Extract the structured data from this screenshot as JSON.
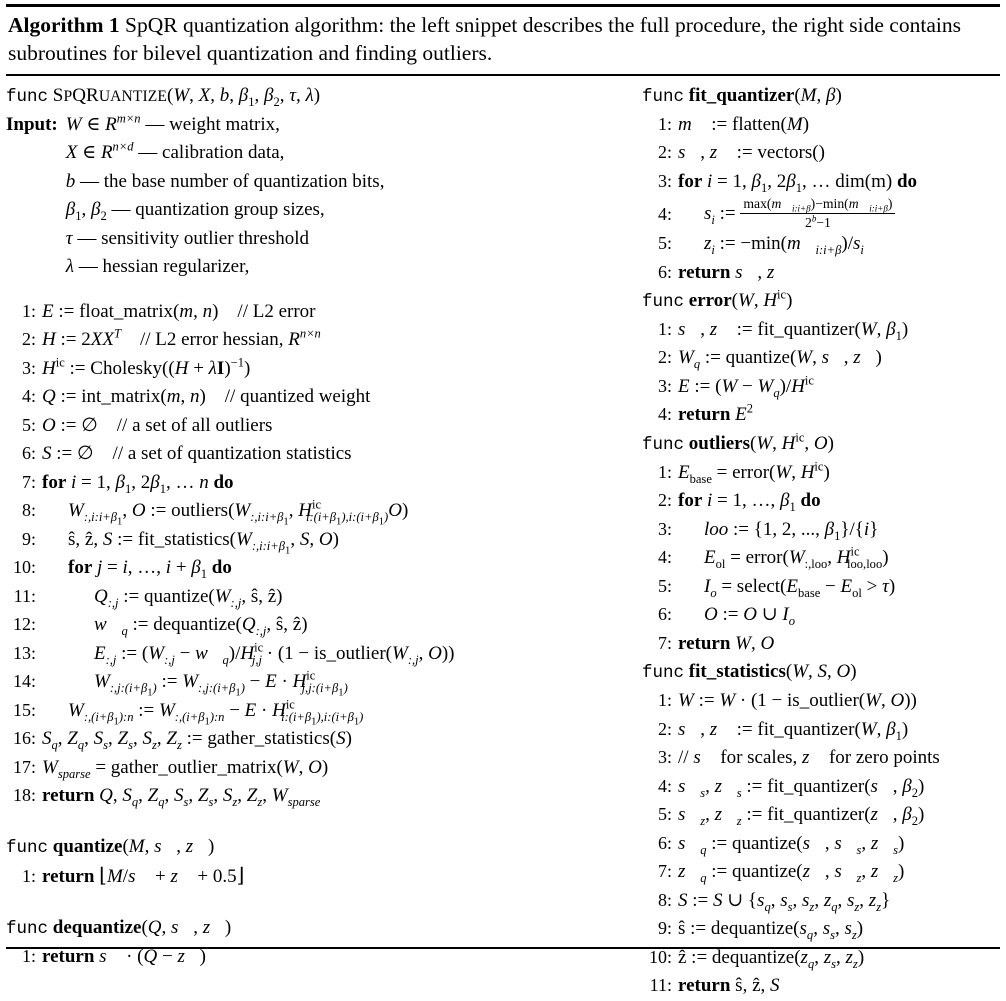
{
  "caption": {
    "label": "Algorithm 1",
    "text": " SpQR quantization algorithm: the left snippet describes the full procedure, the right side contains subroutines for bilevel quantization and finding outliers."
  },
  "keywords": {
    "func": "func",
    "input": "Input:",
    "for": "for",
    "do": "do",
    "return": "return"
  },
  "left_column": {
    "main_proc": {
      "name": "SpQRQuantize",
      "signature": "(W, X, b, β₁, β₂, τ, λ)",
      "input_lines": [
        "W ∈ R^{m×n} — weight matrix,",
        "X ∈ R^{n×d} — calibration data,",
        "b — the base number of quantization bits,",
        "β₁, β₂ — quantization group sizes,",
        "τ — sensitivity outlier threshold",
        "λ — hessian regularizer,"
      ],
      "steps": [
        {
          "n": "1:",
          "text": "E := float_matrix(m, n)    // L2 error"
        },
        {
          "n": "2:",
          "text": "H := 2XX^T    // L2 error hessian, R^{n×n}"
        },
        {
          "n": "3:",
          "text": "H^ic := Cholesky((H + λI)^{-1})"
        },
        {
          "n": "4:",
          "text": "Q := int_matrix(m, n)    // quantized weight"
        },
        {
          "n": "5:",
          "text": "O := ∅    // a set of all outliers"
        },
        {
          "n": "6:",
          "text": "S := ∅    // a set of quantization statistics"
        },
        {
          "n": "7:",
          "text": "for i = 1, β₁, 2β₁, … n do"
        },
        {
          "n": "8:",
          "text": "W_{:,i:i+β₁}, O := outliers(W_{:,i:i+β₁}, H^ic_{i:(i+β₁),i:(i+β₁)}O)"
        },
        {
          "n": "9:",
          "text": "ŝ, ẑ, S := fit_statistics(W_{:,i:i+β₁}, S, O)"
        },
        {
          "n": "10:",
          "text": "for j = i, …, i + β₁ do"
        },
        {
          "n": "11:",
          "text": "Q_{:,j} := quantize(W_{:,j}, ŝ, ẑ)"
        },
        {
          "n": "12:",
          "text": "w⃗_q := dequantize(Q_{:,j}, ŝ, ẑ)"
        },
        {
          "n": "13:",
          "text": "E_{:,j} := (W_{:,j} − w⃗_q)/H^ic_{j,j} · (1 − is_outlier(W_{:,j}, O))"
        },
        {
          "n": "14:",
          "text": "W_{:,j:(i+β₁)} := W_{:,j:(i+β₁)} − E · H^ic_{j,j:(i+β₁)}"
        },
        {
          "n": "15:",
          "text": "W_{:,(i+β₁):n} := W_{:,(i+β₁):n} − E · H^ic_{i:(i+β₁),i:(i+β₁)}"
        },
        {
          "n": "16:",
          "text": "S_q, Z_q, S_s, Z_s, S_z, Z_z := gather_statistics(S)"
        },
        {
          "n": "17:",
          "text": "W_sparse = gather_outlier_matrix(W, O)"
        },
        {
          "n": "18:",
          "text": "return Q, S_q, Z_q, S_s, Z_s, S_z, Z_z, W_sparse"
        }
      ]
    },
    "quantize": {
      "name": "quantize",
      "signature": "(M, s⃗, z⃗)",
      "steps": [
        {
          "n": "1:",
          "text": "return ⌊M/s⃗ + z⃗ + 0.5⌋"
        }
      ]
    },
    "dequantize": {
      "name": "dequantize",
      "signature": "(Q, s⃗, z⃗)",
      "steps": [
        {
          "n": "1:",
          "text": "return s⃗ · (Q − z⃗)"
        }
      ]
    }
  },
  "right_column": {
    "fit_quantizer": {
      "name": "fit_quantizer",
      "signature": "(M, β)",
      "steps": [
        {
          "n": "1:",
          "text": "m⃗ := flatten(M)"
        },
        {
          "n": "2:",
          "text": "s⃗, z⃗ := vectors()"
        },
        {
          "n": "3:",
          "text": "for i = 1, β₁, 2β₁, … dim(m) do"
        },
        {
          "n": "4:",
          "text": "s_i := (max(m⃗_{i:i+β}) − min(m⃗_{i:i+β})) / (2^b − 1)"
        },
        {
          "n": "5:",
          "text": "z_i := −min(m⃗_{i:i+β})/s_i"
        },
        {
          "n": "6:",
          "text": "return s⃗, z⃗"
        }
      ]
    },
    "error": {
      "name": "error",
      "signature": "(W, H^ic)",
      "steps": [
        {
          "n": "1:",
          "text": "s⃗, z⃗ := fit_quantizer(W, β₁)"
        },
        {
          "n": "2:",
          "text": "W_q := quantize(W, s⃗, z⃗)"
        },
        {
          "n": "3:",
          "text": "E := (W − W_q)/H^ic"
        },
        {
          "n": "4:",
          "text": "return E²"
        }
      ]
    },
    "outliers": {
      "name": "outliers",
      "signature": "(W, H^ic, O)",
      "steps": [
        {
          "n": "1:",
          "text": "E_base = error(W, H^ic)"
        },
        {
          "n": "2:",
          "text": "for i = 1, …, β₁ do"
        },
        {
          "n": "3:",
          "text": "loo := {1, 2, …, β₁}/{i}"
        },
        {
          "n": "4:",
          "text": "E_ol = error(W_{:,loo}, H^ic_{loo,loo})"
        },
        {
          "n": "5:",
          "text": "I_o = select(E_base − E_ol > τ)"
        },
        {
          "n": "6:",
          "text": "O := O ∪ I_o"
        },
        {
          "n": "7:",
          "text": "return W, O"
        }
      ]
    },
    "fit_statistics": {
      "name": "fit_statistics",
      "signature": "(W, S, O)",
      "steps": [
        {
          "n": "1:",
          "text": "W := W · (1 − is_outlier(W, O))"
        },
        {
          "n": "2:",
          "text": "s⃗, z⃗ := fit_quantizer(W, β₁)"
        },
        {
          "n": "3:",
          "text": "// s⃗ for scales, z⃗ for zero points"
        },
        {
          "n": "4:",
          "text": "s⃗_s, z⃗_s := fit_quantizer(s⃗, β₂)"
        },
        {
          "n": "5:",
          "text": "s⃗_z, z⃗_z := fit_quantizer(z⃗, β₂)"
        },
        {
          "n": "6:",
          "text": "s⃗_q := quantize(s⃗, s⃗_s, z⃗_s)"
        },
        {
          "n": "7:",
          "text": "z⃗_q := quantize(z⃗, s⃗_z, z⃗_z)"
        },
        {
          "n": "8:",
          "text": "S := S ∪ {s_q, s_s, s_z, z_q, s_z, z_z}"
        },
        {
          "n": "9:",
          "text": "ŝ := dequantize(s_q, s_s, s_z)"
        },
        {
          "n": "10:",
          "text": "ẑ := dequantize(z_q, z_s, z_z)"
        },
        {
          "n": "11:",
          "text": "return ŝ, ẑ, S"
        }
      ]
    }
  }
}
